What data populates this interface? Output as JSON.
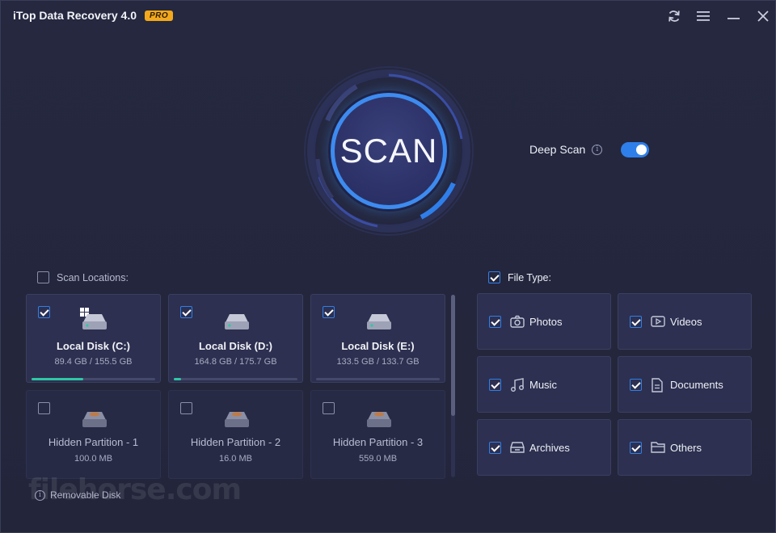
{
  "window": {
    "title": "iTop Data Recovery 4.0",
    "badge": "PRO"
  },
  "scan": {
    "label": "SCAN",
    "deep_scan_label": "Deep Scan",
    "deep_scan_enabled": true
  },
  "locations": {
    "label": "Scan Locations:",
    "disks": [
      {
        "name": "Local Disk (C:)",
        "size": "89.4 GB / 155.5 GB",
        "checked": true,
        "used": 0.575,
        "system": true
      },
      {
        "name": "Local Disk (D:)",
        "size": "164.8 GB / 175.7 GB",
        "checked": true,
        "used": 0.06,
        "system": false
      },
      {
        "name": "Local Disk (E:)",
        "size": "133.5 GB / 133.7 GB",
        "checked": true,
        "used": 0.0,
        "system": false
      },
      {
        "name": "Hidden Partition - 1",
        "size": "100.0 MB",
        "checked": false
      },
      {
        "name": "Hidden Partition - 2",
        "size": "16.0 MB",
        "checked": false
      },
      {
        "name": "Hidden Partition - 3",
        "size": "559.0 MB",
        "checked": false
      }
    ],
    "removable_label": "Removable Disk"
  },
  "file_types": {
    "label": "File Type:",
    "items": [
      {
        "label": "Photos",
        "icon": "camera-icon",
        "checked": true
      },
      {
        "label": "Videos",
        "icon": "video-icon",
        "checked": true
      },
      {
        "label": "Music",
        "icon": "music-icon",
        "checked": true
      },
      {
        "label": "Documents",
        "icon": "document-icon",
        "checked": true
      },
      {
        "label": "Archives",
        "icon": "archive-icon",
        "checked": true
      },
      {
        "label": "Others",
        "icon": "folder-icon",
        "checked": true
      }
    ]
  },
  "watermark": "filehorse.com",
  "colors": {
    "accent": "#2f7fea",
    "progress": "#2ec7a6",
    "badge": "#f3a81c",
    "background": "#23253f"
  }
}
